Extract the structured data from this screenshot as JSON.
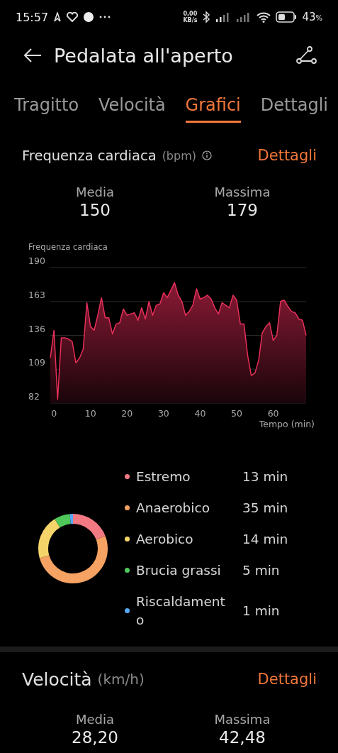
{
  "status_bar": {
    "time": "15:57",
    "net_speed_value": "0,00",
    "net_speed_unit": "KB/s",
    "battery_percent": "43",
    "battery_unit": "%"
  },
  "header": {
    "title": "Pedalata all'aperto"
  },
  "tabs": [
    {
      "label": "Tragitto",
      "selected": false
    },
    {
      "label": "Velocità",
      "selected": false
    },
    {
      "label": "Grafici",
      "selected": true
    },
    {
      "label": "Dettagli",
      "selected": false
    }
  ],
  "heart_rate": {
    "title": "Frequenza cardiaca",
    "unit": "(bpm)",
    "details_link": "Dettagli",
    "stats": [
      {
        "label": "Media",
        "value": "150"
      },
      {
        "label": "Massima",
        "value": "179"
      }
    ],
    "chart_data": {
      "type": "area",
      "grid": true,
      "xlim": [
        -1,
        69
      ],
      "xlabel": "Tempo (min)",
      "ylim": [
        82,
        190
      ],
      "yticks": [
        82,
        109,
        136,
        163,
        190
      ],
      "xticks": [
        0,
        10,
        20,
        30,
        40,
        50,
        60
      ],
      "x": [
        -1,
        0,
        1,
        2,
        3,
        4,
        5,
        6,
        7,
        8,
        9,
        10,
        11,
        12,
        13,
        14,
        15,
        16,
        17,
        18,
        19,
        20,
        21,
        22,
        23,
        24,
        25,
        26,
        27,
        28,
        29,
        30,
        31,
        32,
        33,
        34,
        35,
        36,
        37,
        38,
        39,
        40,
        41,
        42,
        43,
        44,
        45,
        46,
        47,
        48,
        49,
        50,
        51,
        52,
        53,
        54,
        55,
        56,
        57,
        58,
        59,
        60,
        61,
        62,
        63,
        64,
        65,
        66,
        67,
        68,
        69
      ],
      "series": [
        {
          "name": "Frequenza cardiaca",
          "color": "#e8305a",
          "values": [
            118,
            140,
            85,
            134,
            134,
            133,
            131,
            114,
            118,
            125,
            162,
            143,
            140,
            152,
            166,
            150,
            150,
            137,
            145,
            146,
            157,
            152,
            153,
            154,
            148,
            158,
            149,
            163,
            152,
            160,
            161,
            170,
            166,
            172,
            178,
            168,
            163,
            152,
            155,
            160,
            173,
            165,
            166,
            168,
            165,
            158,
            153,
            162,
            160,
            158,
            168,
            164,
            145,
            145,
            120,
            104,
            106,
            116,
            138,
            143,
            146,
            132,
            136,
            163,
            164,
            159,
            155,
            154,
            149,
            148,
            136
          ]
        }
      ]
    },
    "zones": {
      "legend": [
        {
          "duration": "13 min",
          "color": "#f37a83"
        },
        {
          "duration": "35 min",
          "color": "#f5a262"
        },
        {
          "duration": "14 min",
          "color": "#f5d46a"
        },
        {
          "duration": "5 min",
          "color": "#4fc75a"
        },
        {
          "duration": "1 min",
          "color": "#58a8f5"
        }
      ],
      "chart_data": {
        "type": "donut",
        "categories": [
          "Estremo",
          "Anaerobico",
          "Aerobico",
          "Brucia grassi",
          "Riscaldament o"
        ],
        "values": [
          19.12,
          51.47,
          20.59,
          7.35,
          1.47
        ]
      }
    }
  },
  "speed": {
    "title": "Velocità",
    "unit": "(km/h)",
    "details_link": "Dettagli",
    "stats": [
      {
        "label": "Media",
        "value": "28,20"
      },
      {
        "label": "Massima",
        "value": "42,48"
      }
    ]
  }
}
